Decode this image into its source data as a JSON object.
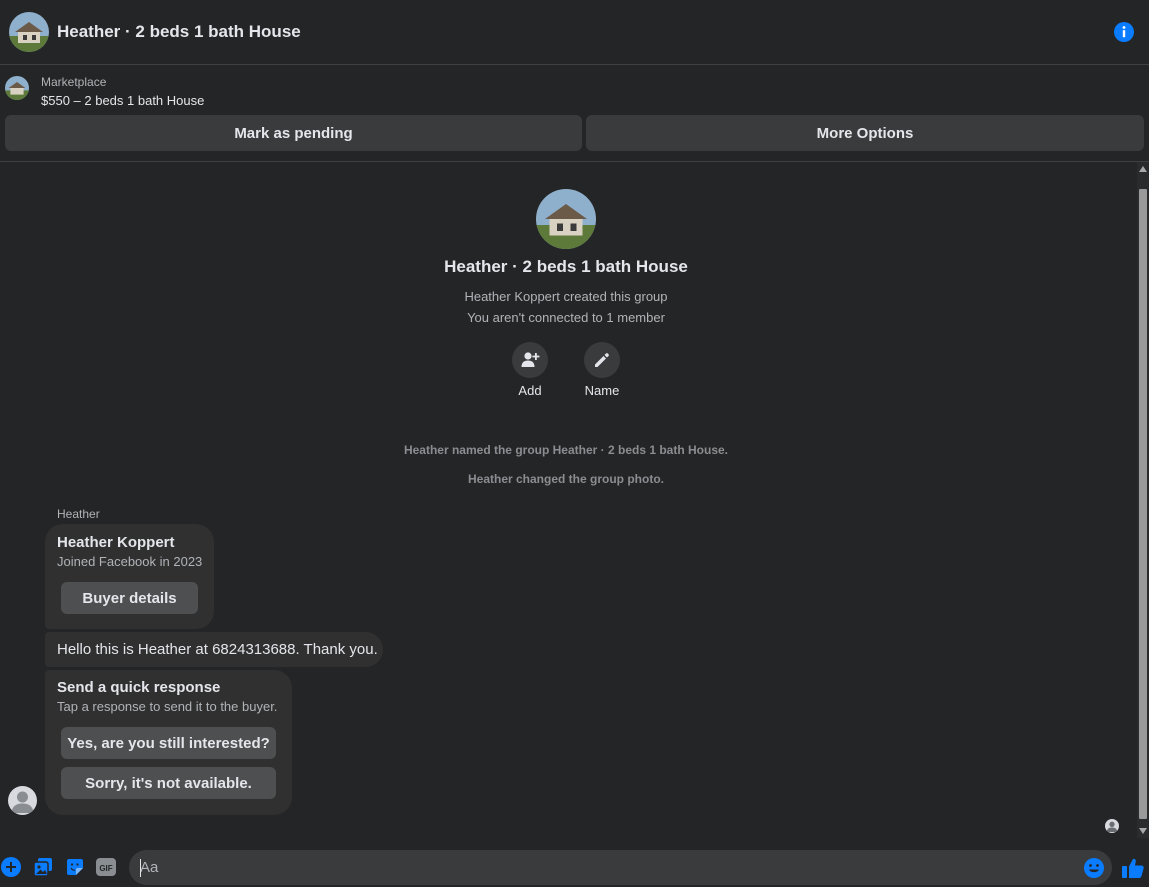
{
  "header": {
    "title": "Heather · 2 beds 1 bath House",
    "avatar_icon": "house-photo",
    "info_icon": "info-icon"
  },
  "marketplace": {
    "kicker": "Marketplace",
    "listing": "$550 – 2 beds 1 bath House"
  },
  "actions": {
    "pending": "Mark as pending",
    "more": "More Options"
  },
  "group": {
    "name": "Heather · 2 beds 1 bath House",
    "created": "Heather Koppert created this group",
    "connection": "You aren't connected to 1 member",
    "add_label": "Add",
    "name_label": "Name"
  },
  "events": [
    "Heather named the group Heather · 2 beds 1 bath House.",
    "Heather changed the group photo."
  ],
  "messages": {
    "sender": "Heather",
    "profile_card": {
      "name": "Heather Koppert",
      "joined": "Joined Facebook in 2023",
      "button": "Buyer details"
    },
    "text": "Hello this is Heather at 6824313688. Thank you.",
    "quick": {
      "title": "Send a quick response",
      "subtitle": "Tap a response to send it to the buyer.",
      "option1": "Yes, are you still interested?",
      "option2": "Sorry, it's not available."
    }
  },
  "composer": {
    "placeholder": "Aa",
    "gif_label": "GIF"
  },
  "colors": {
    "accent": "#0a7cff",
    "background": "#242526",
    "bubble": "#303030",
    "button": "#3a3b3c"
  }
}
